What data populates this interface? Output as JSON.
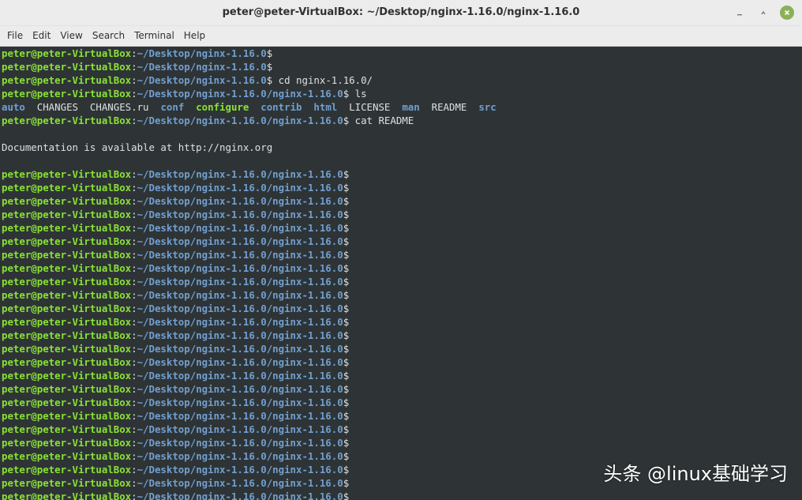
{
  "window": {
    "title": "peter@peter-VirtualBox: ~/Desktop/nginx-1.16.0/nginx-1.16.0",
    "buttons": [
      "minimize-icon",
      "maximize-icon",
      "close-icon"
    ]
  },
  "menubar": {
    "items": [
      "File",
      "Edit",
      "View",
      "Search",
      "Terminal",
      "Help"
    ]
  },
  "prompt": {
    "user": "peter@peter-VirtualBox",
    "separator": ":",
    "dollar": "$"
  },
  "colors": {
    "background": "#2e3436",
    "user": "#8ae234",
    "path": "#729fcf",
    "text": "#e0e0e0"
  },
  "lines": [
    {
      "type": "prompt",
      "path": "~/Desktop/nginx-1.16.0",
      "cmd": ""
    },
    {
      "type": "prompt",
      "path": "~/Desktop/nginx-1.16.0",
      "cmd": ""
    },
    {
      "type": "prompt",
      "path": "~/Desktop/nginx-1.16.0",
      "cmd": " cd nginx-1.16.0/"
    },
    {
      "type": "prompt",
      "path": "~/Desktop/nginx-1.16.0/nginx-1.16.0",
      "cmd": " ls"
    },
    {
      "type": "ls",
      "entries": [
        {
          "name": "auto",
          "kind": "dir"
        },
        {
          "name": "CHANGES",
          "kind": "file"
        },
        {
          "name": "CHANGES.ru",
          "kind": "file"
        },
        {
          "name": "conf",
          "kind": "dir"
        },
        {
          "name": "configure",
          "kind": "exe"
        },
        {
          "name": "contrib",
          "kind": "dir"
        },
        {
          "name": "html",
          "kind": "dir"
        },
        {
          "name": "LICENSE",
          "kind": "file"
        },
        {
          "name": "man",
          "kind": "dir"
        },
        {
          "name": "README",
          "kind": "file"
        },
        {
          "name": "src",
          "kind": "dir"
        }
      ]
    },
    {
      "type": "prompt",
      "path": "~/Desktop/nginx-1.16.0/nginx-1.16.0",
      "cmd": " cat README"
    },
    {
      "type": "text",
      "text": ""
    },
    {
      "type": "text",
      "text": "Documentation is available at http://nginx.org"
    },
    {
      "type": "text",
      "text": ""
    },
    {
      "type": "prompt",
      "path": "~/Desktop/nginx-1.16.0/nginx-1.16.0",
      "cmd": ""
    },
    {
      "type": "prompt",
      "path": "~/Desktop/nginx-1.16.0/nginx-1.16.0",
      "cmd": ""
    },
    {
      "type": "prompt",
      "path": "~/Desktop/nginx-1.16.0/nginx-1.16.0",
      "cmd": ""
    },
    {
      "type": "prompt",
      "path": "~/Desktop/nginx-1.16.0/nginx-1.16.0",
      "cmd": ""
    },
    {
      "type": "prompt",
      "path": "~/Desktop/nginx-1.16.0/nginx-1.16.0",
      "cmd": ""
    },
    {
      "type": "prompt",
      "path": "~/Desktop/nginx-1.16.0/nginx-1.16.0",
      "cmd": ""
    },
    {
      "type": "prompt",
      "path": "~/Desktop/nginx-1.16.0/nginx-1.16.0",
      "cmd": ""
    },
    {
      "type": "prompt",
      "path": "~/Desktop/nginx-1.16.0/nginx-1.16.0",
      "cmd": ""
    },
    {
      "type": "prompt",
      "path": "~/Desktop/nginx-1.16.0/nginx-1.16.0",
      "cmd": ""
    },
    {
      "type": "prompt",
      "path": "~/Desktop/nginx-1.16.0/nginx-1.16.0",
      "cmd": ""
    },
    {
      "type": "prompt",
      "path": "~/Desktop/nginx-1.16.0/nginx-1.16.0",
      "cmd": ""
    },
    {
      "type": "prompt",
      "path": "~/Desktop/nginx-1.16.0/nginx-1.16.0",
      "cmd": ""
    },
    {
      "type": "prompt",
      "path": "~/Desktop/nginx-1.16.0/nginx-1.16.0",
      "cmd": ""
    },
    {
      "type": "prompt",
      "path": "~/Desktop/nginx-1.16.0/nginx-1.16.0",
      "cmd": ""
    },
    {
      "type": "prompt",
      "path": "~/Desktop/nginx-1.16.0/nginx-1.16.0",
      "cmd": ""
    },
    {
      "type": "prompt",
      "path": "~/Desktop/nginx-1.16.0/nginx-1.16.0",
      "cmd": ""
    },
    {
      "type": "prompt",
      "path": "~/Desktop/nginx-1.16.0/nginx-1.16.0",
      "cmd": ""
    },
    {
      "type": "prompt",
      "path": "~/Desktop/nginx-1.16.0/nginx-1.16.0",
      "cmd": ""
    },
    {
      "type": "prompt",
      "path": "~/Desktop/nginx-1.16.0/nginx-1.16.0",
      "cmd": ""
    },
    {
      "type": "prompt",
      "path": "~/Desktop/nginx-1.16.0/nginx-1.16.0",
      "cmd": ""
    },
    {
      "type": "prompt",
      "path": "~/Desktop/nginx-1.16.0/nginx-1.16.0",
      "cmd": ""
    },
    {
      "type": "prompt",
      "path": "~/Desktop/nginx-1.16.0/nginx-1.16.0",
      "cmd": ""
    },
    {
      "type": "prompt",
      "path": "~/Desktop/nginx-1.16.0/nginx-1.16.0",
      "cmd": ""
    },
    {
      "type": "prompt",
      "path": "~/Desktop/nginx-1.16.0/nginx-1.16.0",
      "cmd": ""
    },
    {
      "type": "prompt",
      "path": "~/Desktop/nginx-1.16.0/nginx-1.16.0",
      "cmd": ""
    },
    {
      "type": "prompt",
      "path": "~/Desktop/nginx-1.16.0/nginx-1.16.0",
      "cmd": ""
    }
  ],
  "watermark": "头条 @linux基础学习"
}
